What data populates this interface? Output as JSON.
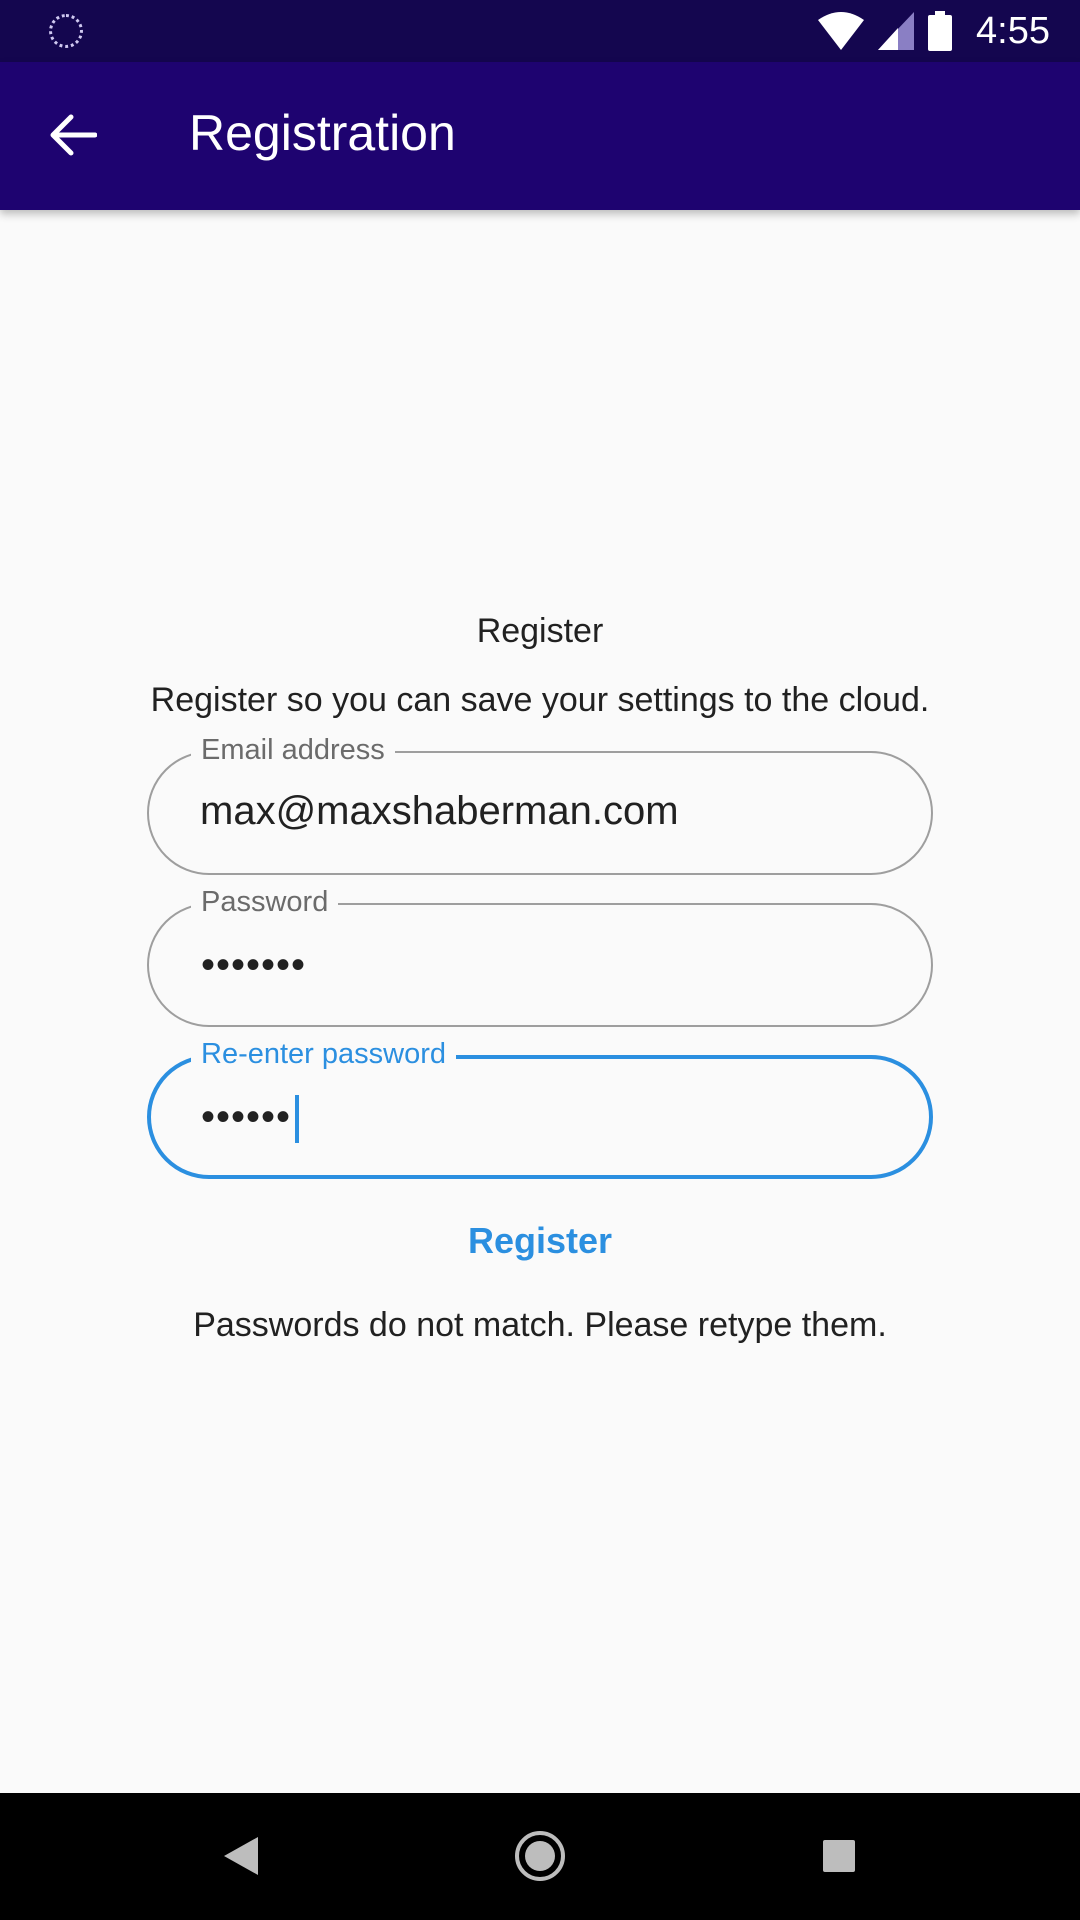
{
  "status_bar": {
    "time": "4:55"
  },
  "app_bar": {
    "title": "Registration"
  },
  "form": {
    "heading": "Register",
    "subtitle": "Register so you can save your settings to the cloud.",
    "email": {
      "label": "Email address",
      "value": "max@maxshaberman.com"
    },
    "password": {
      "label": "Password",
      "value": "•••••••"
    },
    "reenter_password": {
      "label": "Re-enter password",
      "value": "••••••"
    },
    "register_label": "Register",
    "error_message": "Passwords do not match. Please retype them."
  },
  "colors": {
    "status_bar": "#14064f",
    "app_bar": "#1e0370",
    "accent": "#2b8fe0",
    "background": "#fafafa"
  }
}
